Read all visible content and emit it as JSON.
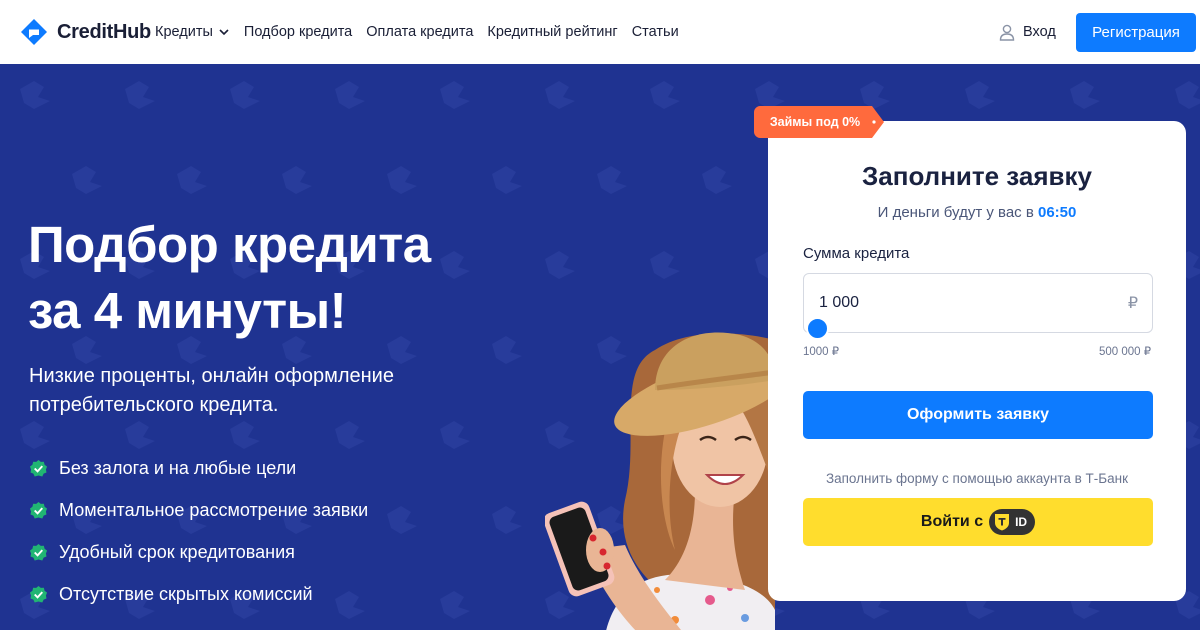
{
  "header": {
    "brand": "CreditHub",
    "nav": [
      {
        "label": "Кредиты",
        "has_dropdown": true
      },
      {
        "label": "Подбор кредита"
      },
      {
        "label": "Оплата кредита"
      },
      {
        "label": "Кредитный рейтинг"
      },
      {
        "label": "Статьи"
      }
    ],
    "login_label": "Вход",
    "register_label": "Регистрация"
  },
  "hero": {
    "title_line1": "Подбор кредита",
    "title_line2": "за 4 минуты!",
    "subtitle": "Низкие проценты, онлайн оформление потребительского кредита.",
    "features": [
      "Без залога и на любые цели",
      "Моментальное рассмотрение заявки",
      "Удобный срок кредитования",
      "Отсутствие скрытых комиссий"
    ]
  },
  "form": {
    "badge": "Займы под 0%",
    "title": "Заполните заявку",
    "subtitle_prefix": "И деньги будут у вас в",
    "subtitle_time": "06:50",
    "amount_label": "Сумма кредита",
    "amount_value": "1 000",
    "currency": "₽",
    "slider_min": "1000 ₽",
    "slider_max": "500 000 ₽",
    "slider_fraction": 0,
    "submit_label": "Оформить заявку",
    "tbank_note": "Заполнить форму с помощью аккаунта в Т-Банк",
    "tid_label": "Войти с",
    "tid_badge": "ID"
  },
  "colors": {
    "hero_bg": "#1f3391",
    "accent": "#0d7bff",
    "promo": "#ff6a3d",
    "tid_yellow": "#ffdd2d",
    "check": "#21b573"
  }
}
